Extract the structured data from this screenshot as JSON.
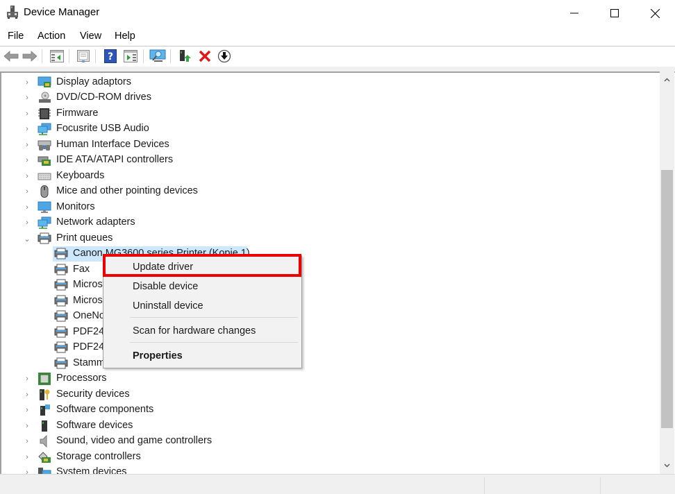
{
  "window": {
    "title": "Device Manager",
    "icon": "device-manager-icon",
    "controls": [
      "minimize",
      "maximize",
      "close"
    ]
  },
  "menubar": {
    "items": [
      {
        "label": "File"
      },
      {
        "label": "Action"
      },
      {
        "label": "View"
      },
      {
        "label": "Help"
      }
    ]
  },
  "toolbar": {
    "buttons": [
      {
        "name": "back-button",
        "icon": "arrow-left-icon"
      },
      {
        "name": "forward-button",
        "icon": "arrow-right-icon"
      },
      {
        "name": "show-hide-console-tree-button",
        "icon": "console-tree-icon"
      },
      {
        "name": "properties-button",
        "icon": "properties-sheet-icon"
      },
      {
        "name": "help-button",
        "icon": "help-icon"
      },
      {
        "name": "show-hide-action-pane-button",
        "icon": "action-pane-icon"
      },
      {
        "name": "scan-hardware-button",
        "icon": "scan-monitor-icon"
      },
      {
        "name": "update-driver-button",
        "icon": "update-driver-icon"
      },
      {
        "name": "uninstall-device-button",
        "icon": "red-x-icon"
      },
      {
        "name": "disable-device-button",
        "icon": "down-arrow-circle-icon"
      }
    ]
  },
  "tree": {
    "categories_before": [
      {
        "label": "Display adaptors",
        "icon": "display-adapter-icon",
        "expanded": false
      },
      {
        "label": "DVD/CD-ROM drives",
        "icon": "dvd-drive-icon",
        "expanded": false
      },
      {
        "label": "Firmware",
        "icon": "firmware-chip-icon",
        "expanded": false
      },
      {
        "label": "Focusrite USB Audio",
        "icon": "network-monitor-icon",
        "expanded": false
      },
      {
        "label": "Human Interface Devices",
        "icon": "hid-icon",
        "expanded": false
      },
      {
        "label": "IDE ATA/ATAPI controllers",
        "icon": "ide-controller-icon",
        "expanded": false
      },
      {
        "label": "Keyboards",
        "icon": "keyboard-icon",
        "expanded": false
      },
      {
        "label": "Mice and other pointing devices",
        "icon": "mouse-icon",
        "expanded": false
      },
      {
        "label": "Monitors",
        "icon": "monitor-icon",
        "expanded": false
      },
      {
        "label": "Network adapters",
        "icon": "network-adapter-icon",
        "expanded": false
      },
      {
        "label": "Print queues",
        "icon": "printer-icon",
        "expanded": true
      }
    ],
    "print_queue_children": [
      {
        "label": "Canon MG3600 series Printer (Kopie 1)",
        "selected": true
      },
      {
        "label": "Fax",
        "selected": false
      },
      {
        "label": "Micros",
        "selected": false
      },
      {
        "label": "Micros",
        "selected": false
      },
      {
        "label": "OneNo",
        "selected": false
      },
      {
        "label": "PDF24",
        "selected": false
      },
      {
        "label": "PDF24",
        "selected": false
      },
      {
        "label": "Stamm",
        "selected": false
      }
    ],
    "categories_after": [
      {
        "label": "Processors",
        "icon": "processor-icon",
        "expanded": false
      },
      {
        "label": "Security devices",
        "icon": "security-key-icon",
        "expanded": false
      },
      {
        "label": "Software components",
        "icon": "software-component-icon",
        "expanded": false
      },
      {
        "label": "Software devices",
        "icon": "software-device-icon",
        "expanded": false
      },
      {
        "label": "Sound, video and game controllers",
        "icon": "speaker-icon",
        "expanded": false
      },
      {
        "label": "Storage controllers",
        "icon": "storage-controller-icon",
        "expanded": false
      },
      {
        "label": "System devices",
        "icon": "system-devices-icon",
        "expanded": false
      }
    ]
  },
  "context_menu": {
    "items": [
      {
        "label": "Update driver",
        "highlighted": true,
        "bold": false
      },
      {
        "label": "Disable device",
        "bold": false
      },
      {
        "label": "Uninstall device",
        "bold": false
      },
      {
        "separator": true
      },
      {
        "label": "Scan for hardware changes",
        "bold": false
      },
      {
        "separator": true
      },
      {
        "label": "Properties",
        "bold": true
      }
    ],
    "highlight_color": "#ee0000"
  },
  "colors": {
    "selection": "#cce8ff",
    "annotation_red": "#ee0000"
  }
}
